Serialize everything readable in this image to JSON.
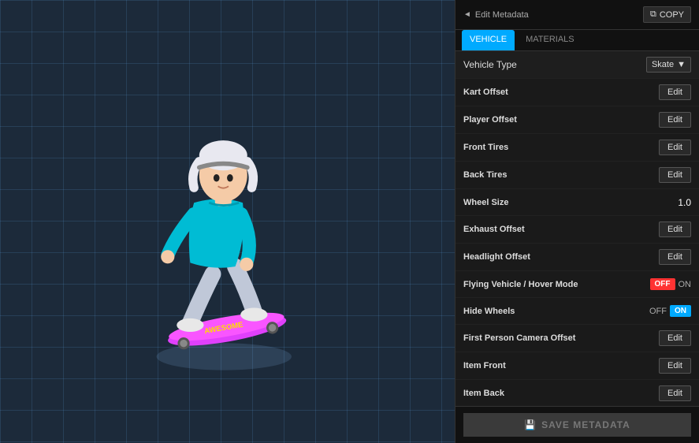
{
  "viewport": {
    "description": "3D viewport showing skateboard character"
  },
  "panel": {
    "header": {
      "back_label": "Edit Metadata",
      "copy_label": "COPY"
    },
    "tabs": [
      {
        "id": "vehicle",
        "label": "VEHICLE",
        "active": true
      },
      {
        "id": "materials",
        "label": "MATERIALS",
        "active": false
      }
    ],
    "vehicle_type": {
      "label": "Vehicle Type",
      "value": "Skate"
    },
    "fields": [
      {
        "label": "Kart Offset",
        "type": "edit",
        "value": null
      },
      {
        "label": "Player Offset",
        "type": "edit",
        "value": null
      },
      {
        "label": "Front Tires",
        "type": "edit",
        "value": null
      },
      {
        "label": "Back Tires",
        "type": "edit",
        "value": null
      },
      {
        "label": "Wheel Size",
        "type": "value",
        "value": "1.0"
      },
      {
        "label": "Exhaust Offset",
        "type": "edit",
        "value": null
      },
      {
        "label": "Headlight Offset",
        "type": "edit",
        "value": null
      },
      {
        "label": "Flying Vehicle / Hover Mode",
        "type": "toggle",
        "state": "off"
      },
      {
        "label": "Hide Wheels",
        "type": "toggle",
        "state": "on"
      },
      {
        "label": "First Person Camera Offset",
        "type": "edit",
        "value": null
      },
      {
        "label": "Item Front",
        "type": "edit",
        "value": null
      },
      {
        "label": "Item Back",
        "type": "edit",
        "value": null
      }
    ],
    "footer": {
      "save_label": "SAVE METADATA",
      "save_icon": "💾"
    },
    "edit_btn_label": "Edit",
    "toggle_off_label": "OFF",
    "toggle_on_label": "ON"
  }
}
